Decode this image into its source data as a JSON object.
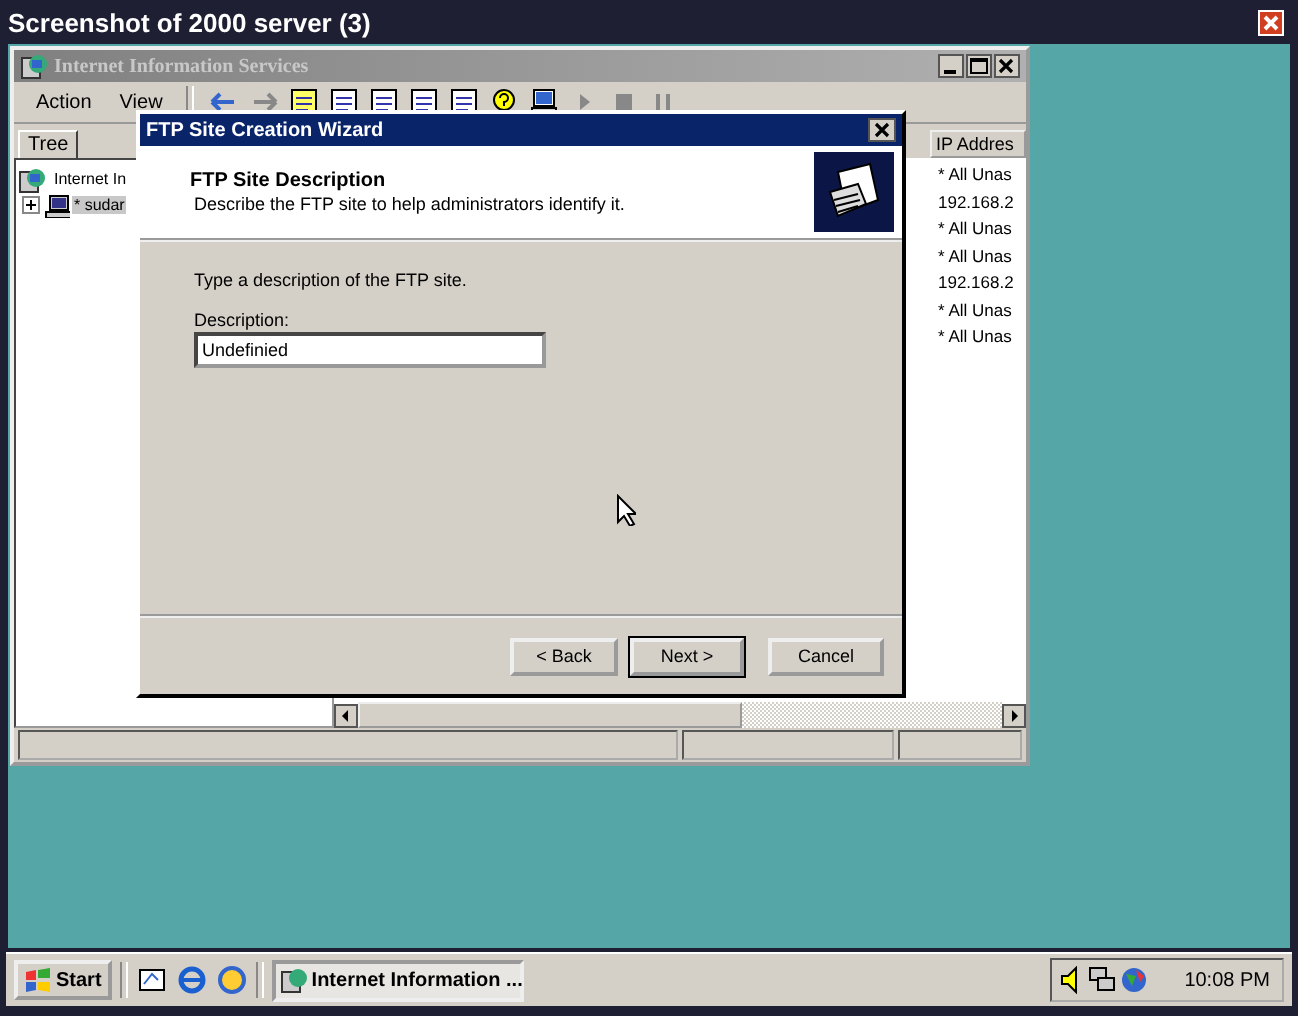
{
  "viewer": {
    "title": "Screenshot of 2000 server (3)"
  },
  "mmc": {
    "title": "Internet Information Services",
    "menu": [
      "Action",
      "View"
    ],
    "tree_tab": "Tree",
    "tree": [
      {
        "label": "Internet In",
        "selected": false,
        "children": [
          {
            "label": "* sudar",
            "expanded": false,
            "selected": true
          }
        ]
      }
    ],
    "column": "IP Addres",
    "ip_cells": [
      "* All Unas",
      "192.168.2",
      "* All Unas",
      "* All Unas",
      "192.168.2",
      "* All Unas",
      "* All Unas"
    ]
  },
  "wizard": {
    "title": "FTP Site Creation Wizard",
    "heading": "FTP Site Description",
    "subheading": "Describe the FTP site to help administrators identify it.",
    "prompt": "Type a description of the FTP site.",
    "field_label": "Description:",
    "field_value": "Undefinied",
    "buttons": [
      {
        "label": "< Back",
        "default": false
      },
      {
        "label": "Next >",
        "default": true
      },
      {
        "label": "Cancel",
        "default": false
      }
    ]
  },
  "taskbar": {
    "start": "Start",
    "tasks": [
      {
        "label": "Internet Information ...",
        "selected": true
      }
    ],
    "clock": "10:08 PM"
  }
}
